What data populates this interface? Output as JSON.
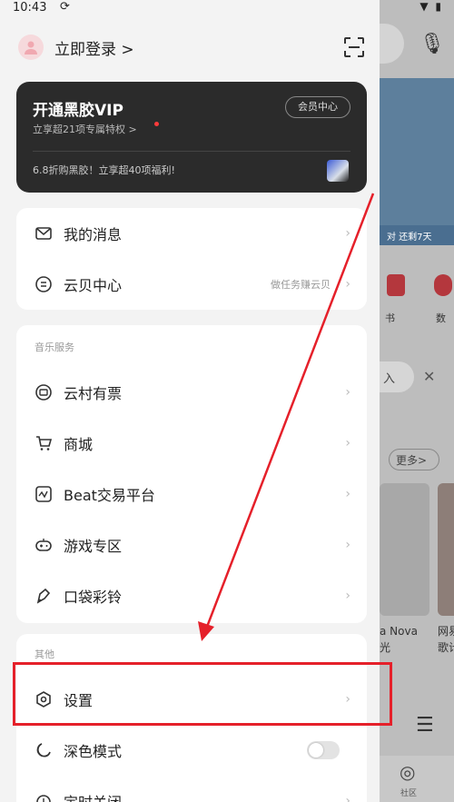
{
  "status": {
    "time": "10:43",
    "network_icon": "sync-icon",
    "system_icons": "wifi-icon battery-icon"
  },
  "header": {
    "login_text": "立即登录 >",
    "scan_icon": "scan-icon"
  },
  "vip": {
    "title": "开通黑胶VIP",
    "subtitle": "立享超21项专属特权 >",
    "center_button": "会员中心",
    "promo": "6.8折购黑胶！立享超40项福利!"
  },
  "account_items": [
    {
      "label": "我的消息",
      "icon": "message-icon"
    },
    {
      "label": "云贝中心",
      "icon": "coin-icon",
      "hint": "做任务赚云贝"
    }
  ],
  "music_services": {
    "section_title": "音乐服务",
    "items": [
      {
        "label": "云村有票",
        "icon": "ticket-icon"
      },
      {
        "label": "商城",
        "icon": "cart-icon"
      },
      {
        "label": "Beat交易平台",
        "icon": "beat-icon"
      },
      {
        "label": "游戏专区",
        "icon": "gamepad-icon"
      },
      {
        "label": "口袋彩铃",
        "icon": "ringtone-icon"
      }
    ]
  },
  "other": {
    "section_title": "其他",
    "items": [
      {
        "label": "设置",
        "icon": "settings-icon"
      },
      {
        "label": "深色模式",
        "icon": "moon-icon",
        "toggle": false
      },
      {
        "label": "定时关闭",
        "icon": "timer-icon"
      }
    ]
  },
  "background_app": {
    "banner_text": "对 还剩7天",
    "icon_labels": [
      "书",
      "数"
    ],
    "chip_text": "入",
    "more_button": "更多>",
    "card_titles": [
      "a Nova\n光",
      "网易\n歌计"
    ],
    "nav_label": "社区"
  },
  "annotation": {
    "highlight_color": "#e5202a",
    "arrow_color": "#e5202a"
  }
}
